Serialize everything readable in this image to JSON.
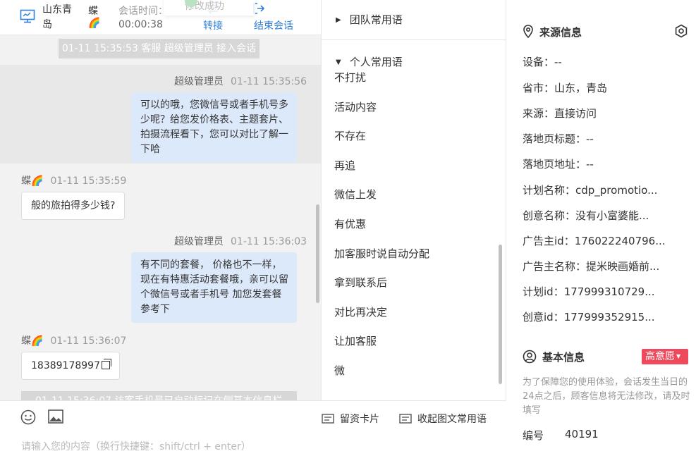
{
  "header": {
    "location": "山东青岛",
    "customer_name": "蝶🌈",
    "session_time_label": "会话时间：",
    "session_time": "00:00:38",
    "toast": "修改成功",
    "transfer_label": "转接",
    "end_label": "结束会话"
  },
  "messages": {
    "system_join": "01-11 15:35:53 客服 超级管理员 接入会话",
    "m1": {
      "sender": "超级管理员",
      "time": "01-11 15:35:56",
      "text": "可以的哦，您微信号或者手机号多少呢？给您发价格表、主题套片、拍摄流程看下，您可以对比了解一下哈"
    },
    "m2": {
      "sender": "蝶🌈",
      "time": "01-11 15:35:59",
      "text": "般的旅拍得多少钱?"
    },
    "m3": {
      "sender": "超级管理员",
      "time": "01-11 15:36:03",
      "text": "有不同的套餐， 价格也不一样，现在有特惠活动套餐哦，亲可以留个微信号或者手机号 加您发套餐参考下"
    },
    "m4": {
      "sender": "蝶🌈",
      "time": "01-11 15:36:07",
      "text": "18389178997"
    },
    "system_phone": "01-11 15:36:07 访客手机号已自动标记在侧基本信息栏"
  },
  "input": {
    "card_label": "留资卡片",
    "collapse_label": "收起图文常用语",
    "placeholder": "请输入您的内容（换行快捷键：shift/ctrl + enter）"
  },
  "phrases": {
    "team_group": "团队常用语",
    "personal_group": "个人常用语",
    "items": [
      "不打扰",
      "活动内容",
      "不存在",
      "再追",
      "微信上发",
      "有优惠",
      "加客服时说自动分配",
      "拿到联系后",
      "对比再决定",
      "让加客服",
      "微"
    ]
  },
  "source_info": {
    "title": "来源信息",
    "device": "设备：--",
    "province": "省市：山东，青岛",
    "source": "来源：直接访问",
    "landing_title": "落地页标题：--",
    "landing_url": "落地页地址：--",
    "plan_name": "计划名称：cdp_promotio...",
    "creative_name": "创意名称：没有小富婆能...",
    "advertiser_id": "广告主id：176022240796...",
    "advertiser_name": "广告主名称：提米映画婚前...",
    "plan_id": "计划id：177999310729...",
    "creative_id": "创意id：177999352915..."
  },
  "basic_info": {
    "title": "基本信息",
    "intent": "高意愿",
    "notice": "为了保障您的使用体验，会话发生当日的24点之后，顾客信息将无法修改，请及时填写",
    "id_label": "编号",
    "id_value": "40191"
  },
  "colors": {
    "accent": "#2f7fd8",
    "bubble_out": "#dce9fb",
    "intent_badge": "#ee4a5c",
    "system_msg": "#d7d7d7"
  }
}
